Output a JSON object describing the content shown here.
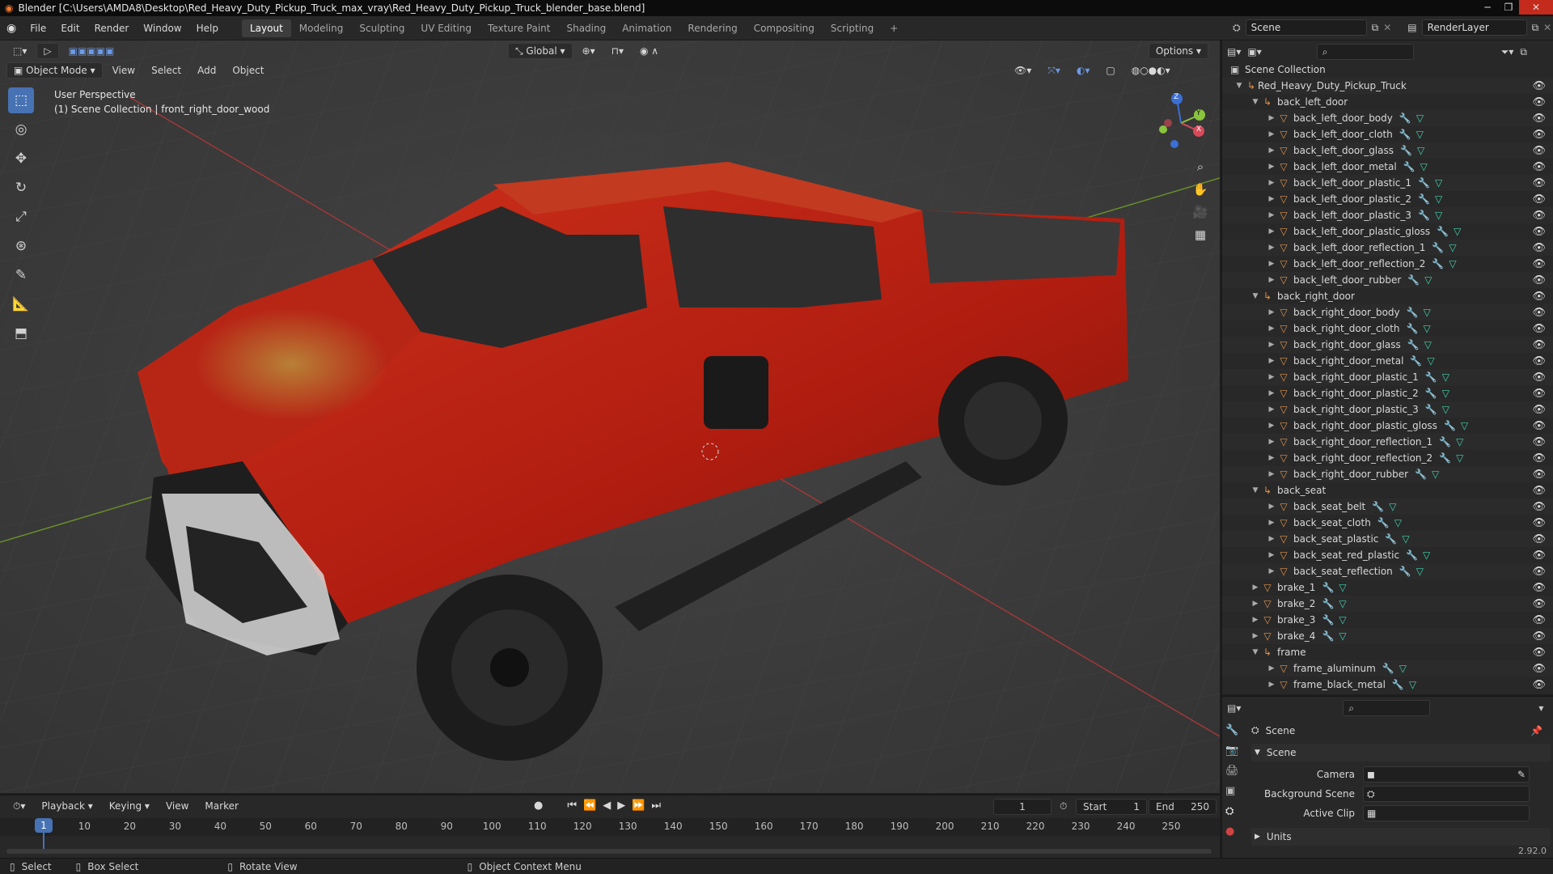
{
  "window": {
    "title": "Blender [C:\\Users\\AMDA8\\Desktop\\Red_Heavy_Duty_Pickup_Truck_max_vray\\Red_Heavy_Duty_Pickup_Truck_blender_base.blend]"
  },
  "menus": [
    "File",
    "Edit",
    "Render",
    "Window",
    "Help"
  ],
  "workspaces": [
    "Layout",
    "Modeling",
    "Sculpting",
    "UV Editing",
    "Texture Paint",
    "Shading",
    "Animation",
    "Rendering",
    "Compositing",
    "Scripting"
  ],
  "scene": {
    "name": "Scene",
    "render_layer": "RenderLayer"
  },
  "viewport": {
    "mode": "Object Mode",
    "menus": [
      "View",
      "Select",
      "Add",
      "Object"
    ],
    "orientation": "Global",
    "options": "Options",
    "overlay_title": "User Perspective",
    "overlay_subtitle": "(1) Scene Collection | front_right_door_wood",
    "gizmo": {
      "x": "X",
      "y": "Y",
      "z": "Z"
    }
  },
  "outliner": {
    "root": "Scene Collection",
    "collection": "Red_Heavy_Duty_Pickup_Truck",
    "rows": [
      {
        "label": "back_left_door",
        "level": 1,
        "kind": "empty",
        "open": true
      },
      {
        "label": "back_left_door_body",
        "level": 2,
        "kind": "mesh"
      },
      {
        "label": "back_left_door_cloth",
        "level": 2,
        "kind": "mesh"
      },
      {
        "label": "back_left_door_glass",
        "level": 2,
        "kind": "mesh"
      },
      {
        "label": "back_left_door_metal",
        "level": 2,
        "kind": "mesh"
      },
      {
        "label": "back_left_door_plastic_1",
        "level": 2,
        "kind": "mesh"
      },
      {
        "label": "back_left_door_plastic_2",
        "level": 2,
        "kind": "mesh"
      },
      {
        "label": "back_left_door_plastic_3",
        "level": 2,
        "kind": "mesh"
      },
      {
        "label": "back_left_door_plastic_gloss",
        "level": 2,
        "kind": "mesh"
      },
      {
        "label": "back_left_door_reflection_1",
        "level": 2,
        "kind": "mesh"
      },
      {
        "label": "back_left_door_reflection_2",
        "level": 2,
        "kind": "mesh"
      },
      {
        "label": "back_left_door_rubber",
        "level": 2,
        "kind": "mesh"
      },
      {
        "label": "back_right_door",
        "level": 1,
        "kind": "empty",
        "open": true
      },
      {
        "label": "back_right_door_body",
        "level": 2,
        "kind": "mesh"
      },
      {
        "label": "back_right_door_cloth",
        "level": 2,
        "kind": "mesh"
      },
      {
        "label": "back_right_door_glass",
        "level": 2,
        "kind": "mesh"
      },
      {
        "label": "back_right_door_metal",
        "level": 2,
        "kind": "mesh"
      },
      {
        "label": "back_right_door_plastic_1",
        "level": 2,
        "kind": "mesh"
      },
      {
        "label": "back_right_door_plastic_2",
        "level": 2,
        "kind": "mesh"
      },
      {
        "label": "back_right_door_plastic_3",
        "level": 2,
        "kind": "mesh"
      },
      {
        "label": "back_right_door_plastic_gloss",
        "level": 2,
        "kind": "mesh"
      },
      {
        "label": "back_right_door_reflection_1",
        "level": 2,
        "kind": "mesh"
      },
      {
        "label": "back_right_door_reflection_2",
        "level": 2,
        "kind": "mesh"
      },
      {
        "label": "back_right_door_rubber",
        "level": 2,
        "kind": "mesh"
      },
      {
        "label": "back_seat",
        "level": 1,
        "kind": "empty",
        "open": true
      },
      {
        "label": "back_seat_belt",
        "level": 2,
        "kind": "mesh"
      },
      {
        "label": "back_seat_cloth",
        "level": 2,
        "kind": "mesh"
      },
      {
        "label": "back_seat_plastic",
        "level": 2,
        "kind": "mesh"
      },
      {
        "label": "back_seat_red_plastic",
        "level": 2,
        "kind": "mesh"
      },
      {
        "label": "back_seat_reflection",
        "level": 2,
        "kind": "mesh"
      },
      {
        "label": "brake_1",
        "level": 1,
        "kind": "mesh"
      },
      {
        "label": "brake_2",
        "level": 1,
        "kind": "mesh"
      },
      {
        "label": "brake_3",
        "level": 1,
        "kind": "mesh"
      },
      {
        "label": "brake_4",
        "level": 1,
        "kind": "mesh"
      },
      {
        "label": "frame",
        "level": 1,
        "kind": "empty",
        "open": true
      },
      {
        "label": "frame_aluminum",
        "level": 2,
        "kind": "mesh"
      },
      {
        "label": "frame_black_metal",
        "level": 2,
        "kind": "mesh"
      }
    ]
  },
  "properties": {
    "context": "Scene",
    "panel": "Scene",
    "fields": [
      {
        "label": "Camera"
      },
      {
        "label": "Background Scene"
      },
      {
        "label": "Active Clip"
      }
    ],
    "collapsed": "Units",
    "version": "2.92.0"
  },
  "timeline": {
    "menus": [
      "Playback",
      "Keying",
      "View",
      "Marker"
    ],
    "current_frame": "1",
    "start_label": "Start",
    "start": "1",
    "end_label": "End",
    "end": "250",
    "ticks": [
      "1",
      "10",
      "20",
      "30",
      "40",
      "50",
      "60",
      "70",
      "80",
      "90",
      "100",
      "110",
      "120",
      "130",
      "140",
      "150",
      "160",
      "170",
      "180",
      "190",
      "200",
      "210",
      "220",
      "230",
      "240",
      "250"
    ]
  },
  "status": {
    "select": "Select",
    "box_select": "Box Select",
    "rotate": "Rotate View",
    "context_menu": "Object Context Menu"
  }
}
